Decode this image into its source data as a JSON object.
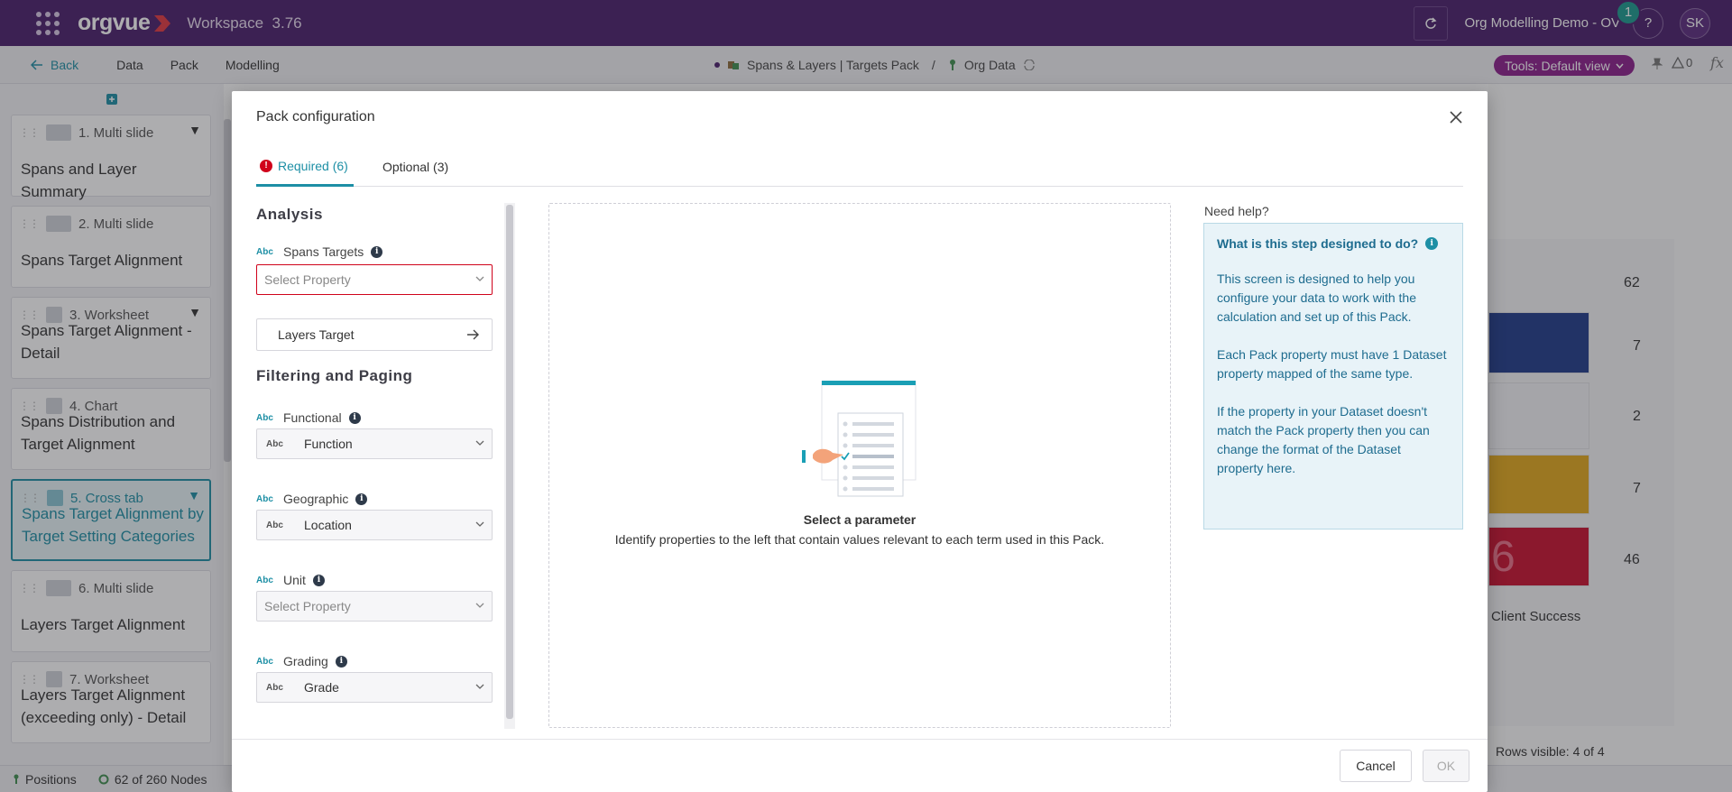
{
  "app": {
    "name": "orgvue",
    "workspace": "Workspace",
    "version": "3.76",
    "project": "Org Modelling Demo - OV",
    "notifications": "1",
    "help": "?",
    "user_initials": "SK"
  },
  "nav": {
    "back": "Back",
    "items": [
      "Data",
      "Pack",
      "Modelling"
    ],
    "crumb1": "Spans & Layers | Targets Pack",
    "separator": "/",
    "crumb2": "Org Data",
    "tools": "Tools: Default view",
    "alerts": "0",
    "fx": "fx"
  },
  "sidebar": {
    "slides": [
      {
        "kind": "1. Multi slide",
        "title": "Spans and Layer Summary"
      },
      {
        "kind": "2. Multi slide",
        "title": "Spans Target Alignment"
      },
      {
        "kind": "3. Worksheet",
        "title": "Spans Target Alignment - Detail"
      },
      {
        "kind": "4. Chart",
        "title": "Spans Distribution and Target Alignment"
      },
      {
        "kind": "5. Cross tab",
        "title": "Spans Target Alignment by Target Setting Categories"
      },
      {
        "kind": "6. Multi slide",
        "title": "Layers Target Alignment"
      },
      {
        "kind": "7. Worksheet",
        "title": "Layers Target Alignment (exceeding only) - Detail"
      }
    ]
  },
  "background": {
    "values": [
      "62",
      "7",
      "2",
      "7",
      "46"
    ],
    "category": "Client Success",
    "rows_visible": "Rows visible: 4 of 4",
    "bar_overlay_text": "6"
  },
  "status": {
    "positions": "Positions",
    "nodes": "62 of 260 Nodes"
  },
  "modal": {
    "title": "Pack configuration",
    "tabs": {
      "required": "Required (6)",
      "optional": "Optional (3)",
      "required_marker": "!"
    },
    "analysis_heading": "Analysis",
    "filtering_heading": "Filtering and Paging",
    "type_tag": "Abc",
    "info_glyph": "i",
    "fields": {
      "spans_targets": {
        "label": "Spans Targets",
        "value": "Select Property"
      },
      "layers_target": {
        "label": "Layers Target"
      },
      "functional": {
        "label": "Functional",
        "value": "Function"
      },
      "geographic": {
        "label": "Geographic",
        "value": "Location"
      },
      "unit": {
        "label": "Unit",
        "value": "Select Property"
      },
      "grading": {
        "label": "Grading",
        "value": "Grade"
      }
    },
    "empty": {
      "title": "Select a parameter",
      "subtitle": "Identify properties to the left that contain values relevant to each term used in this Pack."
    },
    "help": {
      "heading": "Need help?",
      "question": "What is this step designed to do?",
      "p1": "This screen is designed to help you configure your data to work with the calculation and set up of this Pack.",
      "p2": "Each Pack property must have 1 Dataset property mapped of the same type.",
      "p3": "If the property in your Dataset doesn't match the Pack property then you can change the format of the Dataset property here."
    },
    "buttons": {
      "cancel": "Cancel",
      "ok": "OK"
    }
  },
  "colors": {
    "brand": "#4a1d6b",
    "accent": "#1d8fa5",
    "error": "#d0021b",
    "tools_pill": "#8b1d8b"
  }
}
